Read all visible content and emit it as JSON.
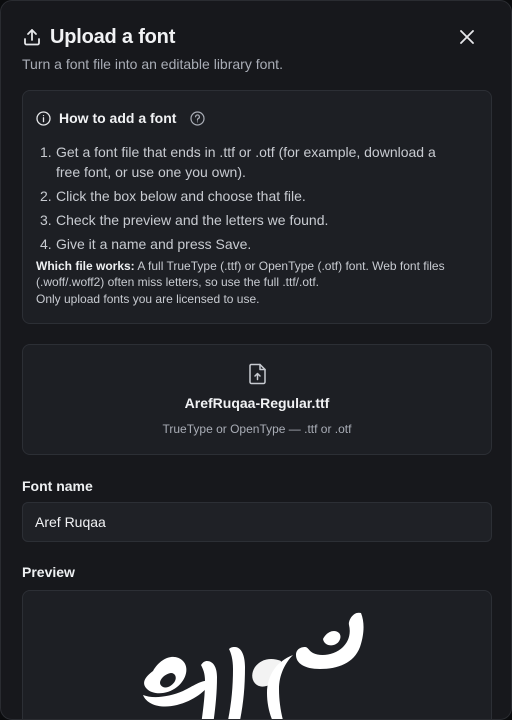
{
  "dialog": {
    "title": "Upload a font",
    "subtitle": "Turn a font file into an editable library font.",
    "close_icon": "close-icon"
  },
  "howto": {
    "title": "How to add a font",
    "steps": [
      {
        "num": "1.",
        "text": "Get a font file that ends in .ttf or .otf (for example, download a free font, or use one you own)."
      },
      {
        "num": "2.",
        "text": "Click the box below and choose that file."
      },
      {
        "num": "3.",
        "text": "Check the preview and the letters we found."
      },
      {
        "num": "4.",
        "text": "Give it a name and press Save."
      }
    ],
    "note_label": "Which file works:",
    "note_text": " A full TrueType (.ttf) or OpenType (.otf) font. Web font files (.woff/.woff2) often miss letters, so use the full .ttf/.otf.",
    "license": "Only upload fonts you are licensed to use."
  },
  "dropzone": {
    "filename": "ArefRuqaa-Regular.ttf",
    "hint": "TrueType or OpenType — .ttf or .otf"
  },
  "font_name": {
    "label": "Font name",
    "value": "Aref Ruqaa"
  },
  "preview": {
    "label": "Preview",
    "sample": "بسم الله"
  },
  "colors": {
    "background": "#17181c",
    "card": "#1d1f24",
    "border": "#2c2f35",
    "text": "#e6e7ea",
    "muted": "#a9adb6"
  }
}
